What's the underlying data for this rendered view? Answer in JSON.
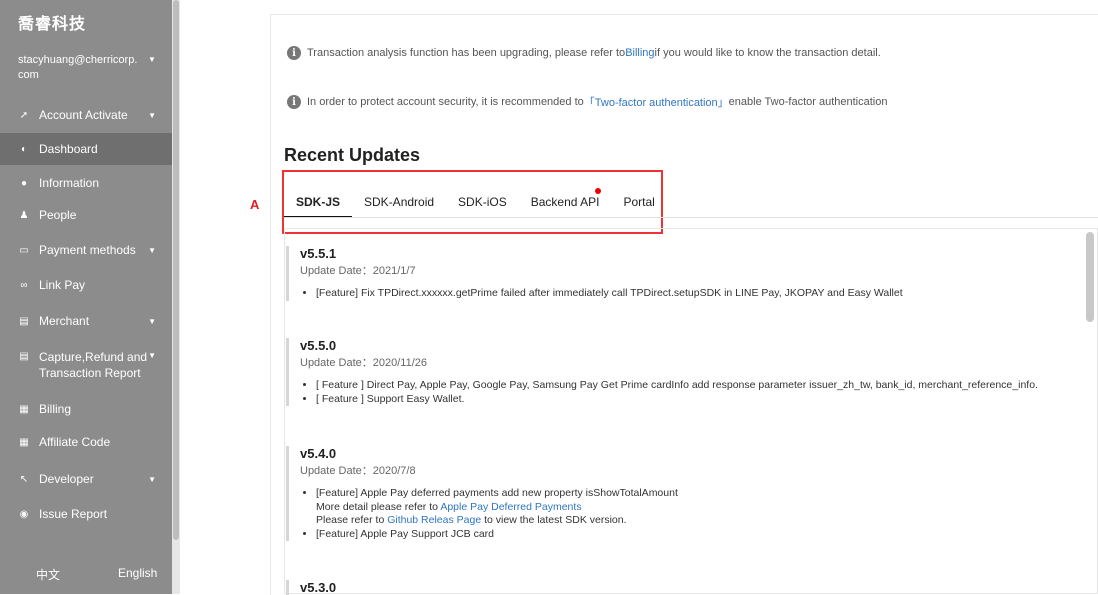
{
  "sidebar": {
    "brand": "喬睿科技",
    "user_email_line1": "stacyhuang@cherricorp.",
    "user_email_line2": "com",
    "items": [
      {
        "label": "Account Activate",
        "icon": "rocket-icon"
      },
      {
        "label": "Dashboard",
        "icon": "dashboard-icon"
      },
      {
        "label": "Information",
        "icon": "info-icon"
      },
      {
        "label": "People",
        "icon": "people-icon"
      },
      {
        "label": "Payment methods",
        "icon": "card-icon"
      },
      {
        "label": "Link Pay",
        "icon": "link-icon"
      },
      {
        "label": "Merchant",
        "icon": "store-icon"
      },
      {
        "label": "Capture,Refund and",
        "label2": "Transaction Report",
        "icon": "report-icon"
      },
      {
        "label": "Billing",
        "icon": "billing-icon"
      },
      {
        "label": "Affiliate Code",
        "icon": "code-icon"
      },
      {
        "label": "Developer",
        "icon": "wrench-icon"
      },
      {
        "label": "Issue Report",
        "icon": "bug-icon"
      }
    ],
    "lang_zh": "中文",
    "lang_en": "English"
  },
  "notices": [
    {
      "pre": "Transaction analysis function has been upgrading, please refer to ",
      "link": "Billing",
      "post": " if you would like to know the transaction detail."
    },
    {
      "pre": "In order to protect account security, it is recommended to ",
      "link": "「Two-factor authentication」",
      "post": " enable Two-factor authentication"
    }
  ],
  "heading": "Recent Updates",
  "marker": "A",
  "tabs": [
    "SDK-JS",
    "SDK-Android",
    "SDK-iOS",
    "Backend API",
    "Portal"
  ],
  "releases": [
    {
      "version": "v5.5.1",
      "date": "Update Date：2021/1/7",
      "notes": [
        "[Feature] Fix TPDirect.xxxxxx.getPrime failed after immediately call TPDirect.setupSDK in LINE Pay, JKOPAY and Easy Wallet"
      ]
    },
    {
      "version": "v5.5.0",
      "date": "Update Date：2020/11/26",
      "notes": [
        "[ Feature ] Direct Pay, Apple Pay, Google Pay, Samsung Pay Get Prime cardInfo add response parameter issuer_zh_tw, bank_id, merchant_reference_info.",
        "[ Feature ] Support Easy Wallet."
      ]
    },
    {
      "version": "v5.4.0",
      "date": "Update Date：2020/7/8",
      "note1": "[Feature] Apple Pay deferred payments add new property isShowTotalAmount",
      "note1_sub1_pre": "More detail please refer to ",
      "note1_sub1_link": "Apple Pay Deferred Payments",
      "note1_sub2_pre": "Please refer to ",
      "note1_sub2_link": "Github Releas Page",
      "note1_sub2_post": " to view the latest SDK version.",
      "note2": "[Feature] Apple Pay Support JCB card"
    },
    {
      "version": "v5.3.0"
    }
  ]
}
